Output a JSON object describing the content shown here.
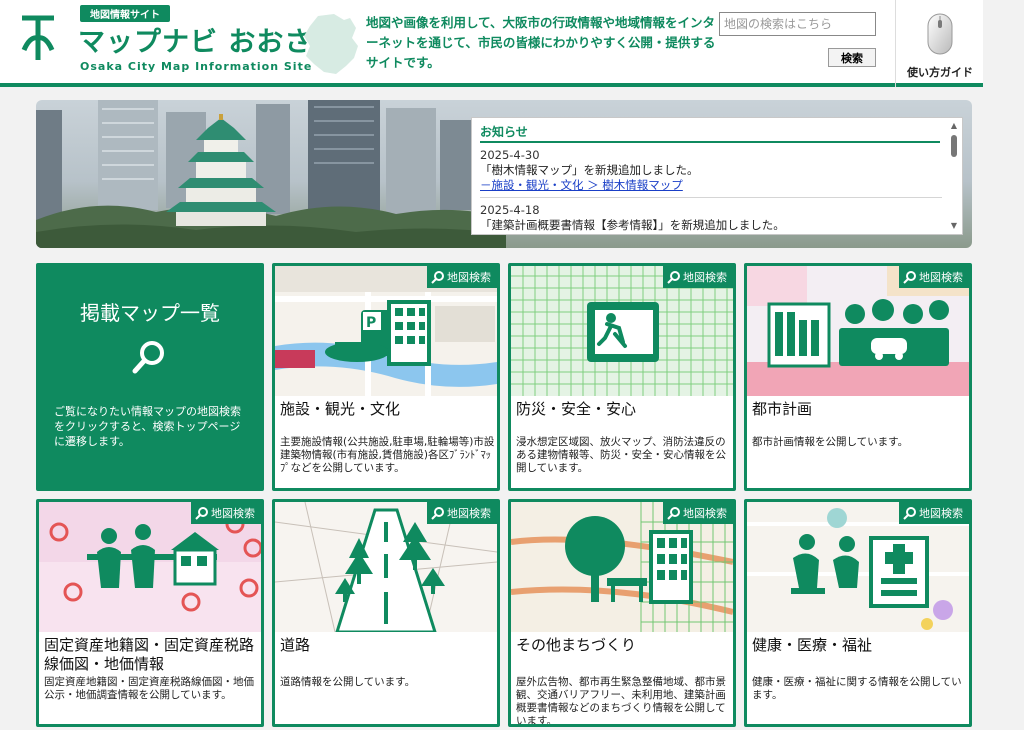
{
  "header": {
    "site_tag": "地図情報サイト",
    "site_title": "マップナビ おおさか",
    "site_subtitle": "Osaka City Map Information Site",
    "intro": "地図や画像を利用して、大阪市の行政情報や地域情報をインターネットを通じて、市民の皆様にわかりやすく公開・提供するサイトです。",
    "search_placeholder": "地図の検索はこちら",
    "search_button": "検索",
    "guide_label": "使い方ガイド",
    "brand_color": "#0f8a5f"
  },
  "news": {
    "title": "お知らせ",
    "items": [
      {
        "date": "2025-4-30",
        "text": "「樹木情報マップ」を新規追加しました。",
        "link": "－施設・観光・文化 ＞ 樹木情報マップ"
      },
      {
        "date": "2025-4-18",
        "text": "「建築計画概要書情報【参考情報】」を新規追加しました。",
        "link": ""
      }
    ]
  },
  "feature": {
    "title": "掲載マップ一覧",
    "description": "ご覧になりたい情報マップの地図検索をクリックすると、検索トップページに遷移します。"
  },
  "badge_label": "地図検索",
  "tiles": [
    {
      "title": "施設・観光・文化",
      "description": "主要施設情報(公共施設,駐車場,駐輪場等)市設建築物情報(市有施設,賃借施設)各区ﾌﾞﾗﾝﾄﾞﾏｯﾌﾟなどを公開しています。"
    },
    {
      "title": "防災・安全・安心",
      "description": "浸水想定区域図、放火マップ、消防法違反のある建物情報等、防災・安全・安心情報を公開しています。"
    },
    {
      "title": "都市計画",
      "description": "都市計画情報を公開しています。"
    },
    {
      "title": "固定資産地籍図・固定資産税路線価図・地価情報",
      "description": "固定資産地籍図・固定資産税路線価図・地価公示・地価調査情報を公開しています。"
    },
    {
      "title": "道路",
      "description": "道路情報を公開しています。"
    },
    {
      "title": "その他まちづくり",
      "description": "屋外広告物、都市再生緊急整備地域、都市景観、交通バリアフリー、未利用地、建築計画概要書情報などのまちづくり情報を公開しています。"
    },
    {
      "title": "健康・医療・福祉",
      "description": "健康・医療・福祉に関する情報を公開しています。"
    }
  ]
}
